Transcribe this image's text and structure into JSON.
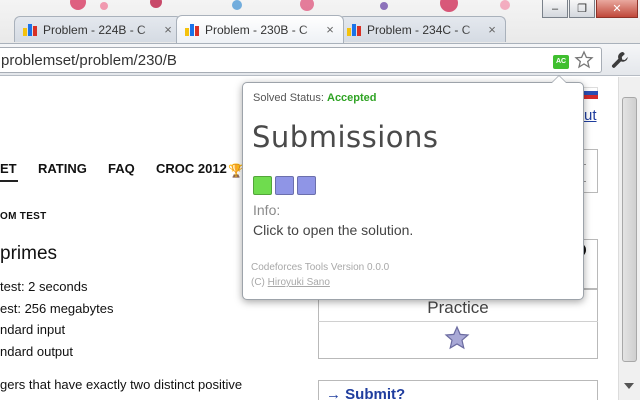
{
  "browser": {
    "tabs": [
      {
        "title": "Problem - 224B - C",
        "active": false
      },
      {
        "title": "Problem - 230B - C",
        "active": true
      },
      {
        "title": "Problem - 234C - C",
        "active": false
      }
    ],
    "close_glyph": "×",
    "window_buttons": [
      "–",
      "❐",
      "✕"
    ],
    "url": "problemset/problem/230/B",
    "extension_badge": "AC"
  },
  "page": {
    "top_link": "ut",
    "menu": [
      "ET",
      "RATING",
      "FAQ",
      "CROC 2012"
    ],
    "custom_test": "OM TEST",
    "problem_name": "primes",
    "properties": [
      "test: 2 seconds",
      "est: 256 megabytes",
      "ndard input",
      "ndard output"
    ],
    "statement_line": "gers that have exactly two distinct positive",
    "sidebar": {
      "practice_label": "Practice",
      "submit_title": "→ Submit?"
    }
  },
  "popup": {
    "status_label": "Solved Status:",
    "status_value": "Accepted",
    "title": "Submissions",
    "submissions": [
      {
        "color": "#6fdc4e",
        "result": "accepted"
      },
      {
        "color": "#8f95e6",
        "result": "other"
      },
      {
        "color": "#8f95e6",
        "result": "other"
      }
    ],
    "info_label": "Info:",
    "info_text": "Click to open the solution.",
    "version": "Codeforces Tools Version 0.0.0",
    "copyright_prefix": "(C)",
    "author": "Hiroyuki Sano"
  },
  "colors": {
    "accepted": "#2fa324",
    "link": "#1f3d9e",
    "badge": "#3fbf2f"
  }
}
